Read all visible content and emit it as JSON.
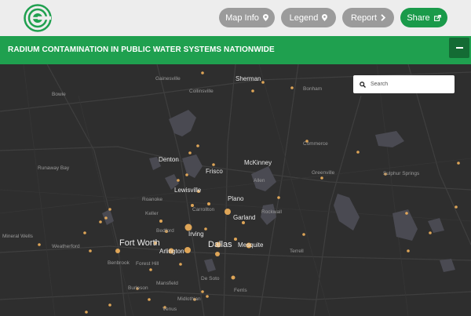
{
  "header": {
    "logo_icon": "ewg-logo-icon",
    "buttons": {
      "map_info": {
        "label": "Map Info",
        "icon": "map-pin-icon"
      },
      "legend": {
        "label": "Legend",
        "icon": "map-pin-icon"
      },
      "report": {
        "label": "Report",
        "icon": "chevron-right-icon"
      },
      "share": {
        "label": "Share",
        "icon": "share-icon"
      }
    }
  },
  "titlebar": {
    "title": "RADIUM CONTAMINATION IN PUBLIC WATER SYSTEMS NATIONWIDE",
    "collapse_icon": "minus-icon"
  },
  "search": {
    "placeholder": "Search",
    "icon": "search-icon"
  },
  "map": {
    "place_labels": {
      "gainesville": "Gainesville",
      "sherman": "Sherman",
      "bowie": "Bowie",
      "collinsville": "Collinsville",
      "bonham": "Bonham",
      "runaway_bay": "Runaway Bay",
      "denton": "Denton",
      "mckinney": "McKinney",
      "frisco": "Frisco",
      "commerce": "Commerce",
      "greenville": "Greenville",
      "sulphur_springs": "Sulphur Springs",
      "allen": "Allen",
      "lewisville": "Lewisville",
      "plano": "Plano",
      "roanoke": "Roanoke",
      "carrollton": "Carrollton",
      "garland": "Garland",
      "rockwall": "Rockwall",
      "keller": "Keller",
      "mineral_wells": "Mineral Wells",
      "irving": "Irving",
      "fort_worth": "Fort Worth",
      "weatherford": "Weatherford",
      "dallas": "Dallas",
      "mesquite": "Mesquite",
      "arlington": "Arlington",
      "terrell": "Terrell",
      "benbrook": "Benbrook",
      "forest_hill": "Forest Hill",
      "mansfield": "Mansfield",
      "desoto": "De Soto",
      "ferris": "Ferris",
      "burleson": "Burleson",
      "midlothian": "Midlothian",
      "venus": "Venus",
      "bedford": "Bedford"
    },
    "colors": {
      "background": "#2e2e2e",
      "water": "#4a4a52",
      "roads": "#3d3d3d",
      "marker": "#f2b25c"
    }
  }
}
